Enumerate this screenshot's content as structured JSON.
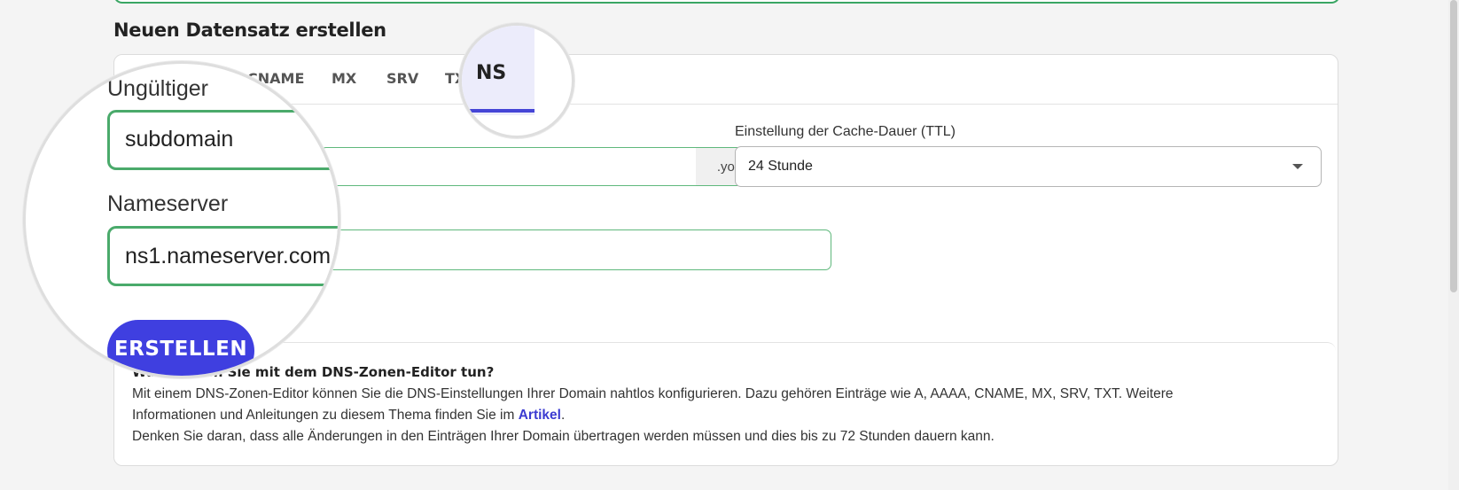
{
  "section_title": "Neuen Datensatz erstellen",
  "tabs": [
    "CNAME",
    "MX",
    "SRV",
    "TX",
    "NS"
  ],
  "active_tab": "NS",
  "form": {
    "subdomain_label": "Ungültiger",
    "subdomain_value": "subdomain",
    "domain_suffix": ".your-domain....",
    "ttl_label": "Einstellung der Cache-Dauer (TTL)",
    "ttl_value": "24 Stunde",
    "nameserver_label": "Nameserver",
    "nameserver_value": "ns1.nameserver.com",
    "submit_label": "ERSTELLEN"
  },
  "info": {
    "title": "Was können Sie mit dem DNS-Zonen-Editor tun?",
    "line1": "Mit einem DNS-Zonen-Editor können Sie die DNS-Einstellungen Ihrer Domain nahtlos konfigurieren. Dazu gehören Einträge wie A, AAAA, CNAME, MX, SRV, TXT. Weitere",
    "line2_prefix": "Informationen und Anleitungen zu diesem Thema finden Sie im",
    "link_text": "Artikel",
    "line2_suffix": ".",
    "line3": "Denken Sie daran, dass alle Änderungen in den Einträgen Ihrer Domain übertragen werden müssen und dies bis zu 72 Stunden dauern kann."
  },
  "colors": {
    "accent": "#3f3fe0",
    "valid_border": "#4aaa6b",
    "link": "#3b3bd1"
  }
}
